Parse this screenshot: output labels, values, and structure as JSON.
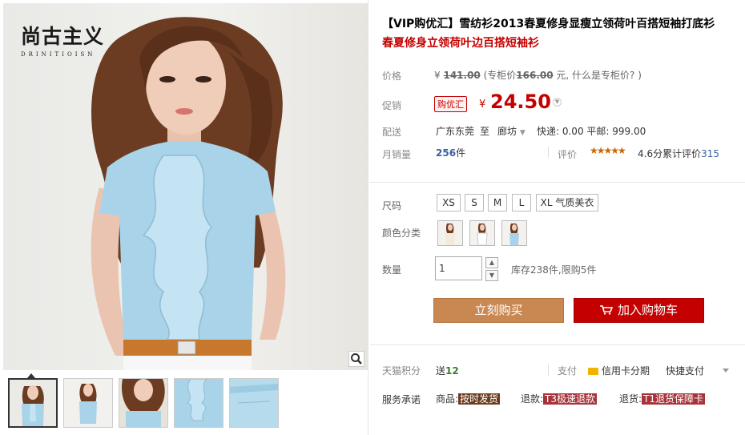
{
  "brand": {
    "name_cn": "尚古主义",
    "name_en": "DRINITIOISN"
  },
  "title": {
    "main": "【VIP购优汇】雪纺衫2013春夏修身显瘦立领荷叶百搭短袖打底衫",
    "sub": "春夏修身立领荷叶边百搭短袖衫"
  },
  "price": {
    "label": "价格",
    "yen": "¥",
    "original": "141.00",
    "counter_prefix": "(专柜价",
    "counter_value": "166.00",
    "counter_suffix": " 元, 什么是专柜价? )"
  },
  "promo": {
    "label": "促销",
    "tag": "购优汇",
    "yen": "¥",
    "value": "24.50"
  },
  "shipping": {
    "label": "配送",
    "from": "广东东莞",
    "to_word": "至",
    "to": "廊坊",
    "express": "快递: 0.00 平邮: 999.00"
  },
  "sales": {
    "label": "月销量",
    "count": "256",
    "unit": "件",
    "review_label": "评价",
    "stars": "★★★★★",
    "score_text": "4.6分累计评价",
    "review_count": "315"
  },
  "size": {
    "label": "尺码",
    "options": [
      "XS",
      "S",
      "M",
      "L",
      "XL 气质美衣"
    ]
  },
  "color": {
    "label": "颜色分类"
  },
  "quantity": {
    "label": "数量",
    "value": "1",
    "stock": "库存238件,限购5件"
  },
  "actions": {
    "buy": "立刻购买",
    "cart": "加入购物车"
  },
  "points": {
    "label": "天猫积分",
    "send": "送",
    "value": "12",
    "pay_label": "支付",
    "credit": "信用卡分期",
    "quick": "快捷支付"
  },
  "service": {
    "label": "服务承诺",
    "goods": "商品:",
    "goods_tag": "按时发货",
    "refund": "退款:",
    "refund_tag": "T3极速退款",
    "return": "退货:",
    "return_tag": "T1退货保障卡"
  },
  "colors": {
    "accent": "#c40000",
    "buy": "#c98852",
    "link": "#3c5e9e"
  }
}
